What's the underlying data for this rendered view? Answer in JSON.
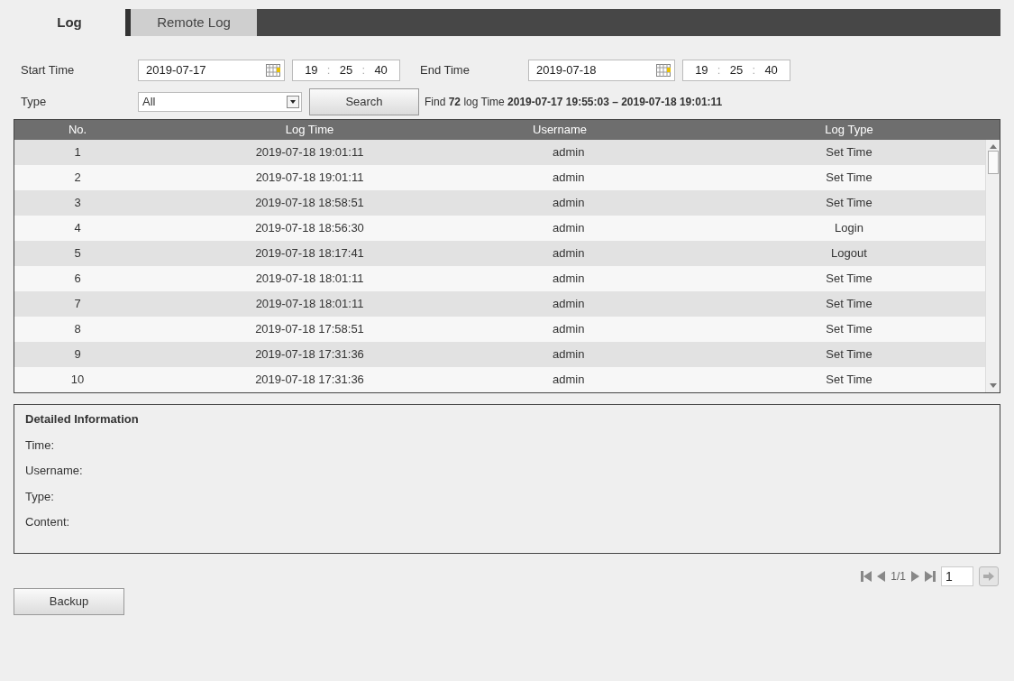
{
  "tabs": [
    {
      "label": "Log",
      "selected": true
    },
    {
      "label": "Remote Log",
      "selected": false
    }
  ],
  "filters": {
    "start_label": "Start Time",
    "start_date": "2019-07-17",
    "start_time": [
      "19",
      ":",
      "25",
      ":",
      "40"
    ],
    "end_label": "End Time",
    "end_date": "2019-07-18",
    "end_time": [
      "19",
      ":",
      "25",
      ":",
      "40"
    ],
    "type_label": "Type",
    "type_value": "All",
    "search_button": "Search",
    "summary": "Find **72** log Time **2019-07-17 19:55:03 – 2019-07-18 19:01:11**"
  },
  "table": {
    "columns": [
      "No.",
      "Log Time",
      "Username",
      "Log Type"
    ],
    "rows": [
      [
        "1",
        "2019-07-18 19:01:11",
        "admin",
        "Set Time"
      ],
      [
        "2",
        "2019-07-18 19:01:11",
        "admin",
        "Set Time"
      ],
      [
        "3",
        "2019-07-18 18:58:51",
        "admin",
        "Set Time"
      ],
      [
        "4",
        "2019-07-18 18:56:30",
        "admin",
        "Login"
      ],
      [
        "5",
        "2019-07-18 18:17:41",
        "admin",
        "Logout"
      ],
      [
        "6",
        "2019-07-18 18:01:11",
        "admin",
        "Set Time"
      ],
      [
        "7",
        "2019-07-18 18:01:11",
        "admin",
        "Set Time"
      ],
      [
        "8",
        "2019-07-18 17:58:51",
        "admin",
        "Set Time"
      ],
      [
        "9",
        "2019-07-18 17:31:36",
        "admin",
        "Set Time"
      ],
      [
        "10",
        "2019-07-18 17:31:36",
        "admin",
        "Set Time"
      ]
    ]
  },
  "details": {
    "title": "Detailed Information",
    "fields": [
      "Time:",
      "Username:",
      "Type:",
      "Content:"
    ]
  },
  "pagination": {
    "page": "1/1",
    "page_input": "1"
  },
  "backup_button": "Backup"
}
